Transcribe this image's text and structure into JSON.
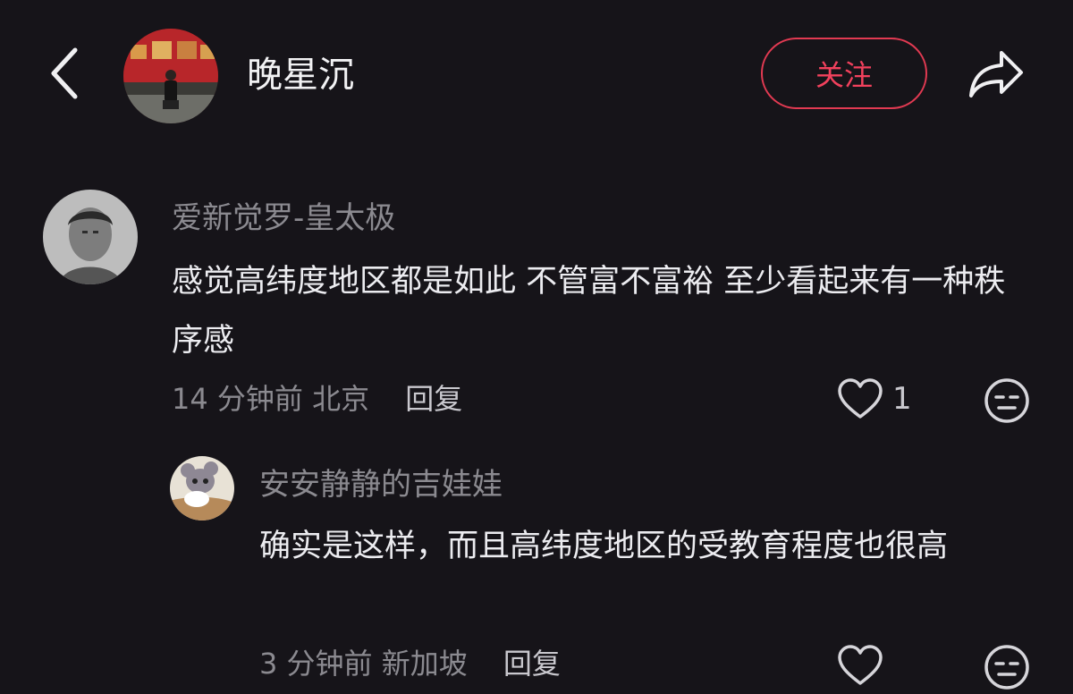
{
  "header": {
    "username": "晚星沉",
    "follow_label": "关注"
  },
  "comments": [
    {
      "author": "爱新觉罗-皇太极",
      "text": "感觉高纬度地区都是如此 不管富不富裕 至少看起来有一种秩序感",
      "time": "14 分钟前",
      "location": "北京",
      "reply_label": "回复",
      "likes": "1"
    },
    {
      "author": "安安静静的吉娃娃",
      "text": "确实是这样，而且高纬度地区的受教育程度也很高",
      "time": "3 分钟前",
      "location": "新加坡",
      "reply_label": "回复"
    }
  ],
  "icons": {
    "back": "chevron-left-icon",
    "share": "share-arrow-icon",
    "like": "heart-outline-icon",
    "dislike": "unamused-face-icon"
  },
  "colors": {
    "background": "#161419",
    "accent": "#f2415d",
    "secondary_text": "#8b8a90"
  }
}
